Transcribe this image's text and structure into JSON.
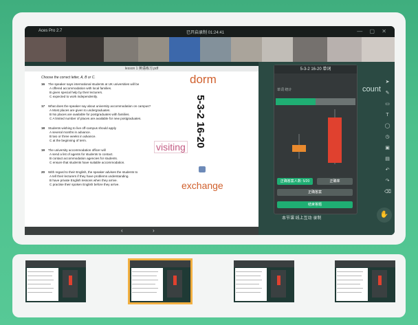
{
  "app": {
    "window_title": "lesson 1 英语练习.pdf",
    "status_left": "Aces Pro 2.7",
    "status_center": "已开启录制 01:24:41",
    "window_controls": "— ▢ ✕"
  },
  "document": {
    "instruction": "Choose the correct letter, A, B or C.",
    "questions": [
      {
        "num": "16",
        "text": "The speaker says international students at UK universities will be",
        "options": [
          "A  offered accommodation with local families.",
          "B  given special help by their lecturers.",
          "C  expected to work independently."
        ]
      },
      {
        "num": "17",
        "text": "What does the speaker say about university accommodation on campus?",
        "options": [
          "A  Most places are given to undergraduates.",
          "B  No places are available for postgraduates with families.",
          "C  A limited number of places are available for new postgraduates."
        ]
      },
      {
        "num": "18",
        "text": "Students wishing to live off-campus should apply",
        "options": [
          "A  several months in advance.",
          "B  two or three weeks in advance.",
          "C  at the beginning of term."
        ]
      },
      {
        "num": "19",
        "text": "The university accommodation officer will",
        "options": [
          "A  send a list of agents for students to contact.",
          "B  contact accommodation agencies for students.",
          "C  ensure that students have suitable accommodation."
        ]
      },
      {
        "num": "20",
        "text": "With regard to their English, the speaker advises the students to",
        "options": [
          "A  tell their lecturers if they have problems understanding.",
          "B  have private English lessons when they arrive.",
          "C  practise their spoken English before they arrive."
        ]
      }
    ]
  },
  "annotations": {
    "dorm": "dorm",
    "numbers": "5-3-2 16-20",
    "visiting": "visiting",
    "exchange": "exchange"
  },
  "timer_panel": {
    "title": "5-3-2 16-20 单词",
    "subtitle": "单词 统计",
    "btn_a": "正确答案人数: 5/20",
    "btn_b": "正确率",
    "btn_c": "正确答案",
    "btn_d": "结束答题"
  },
  "side_label": "count",
  "bottom_text": "本节课 线上互动 录制"
}
